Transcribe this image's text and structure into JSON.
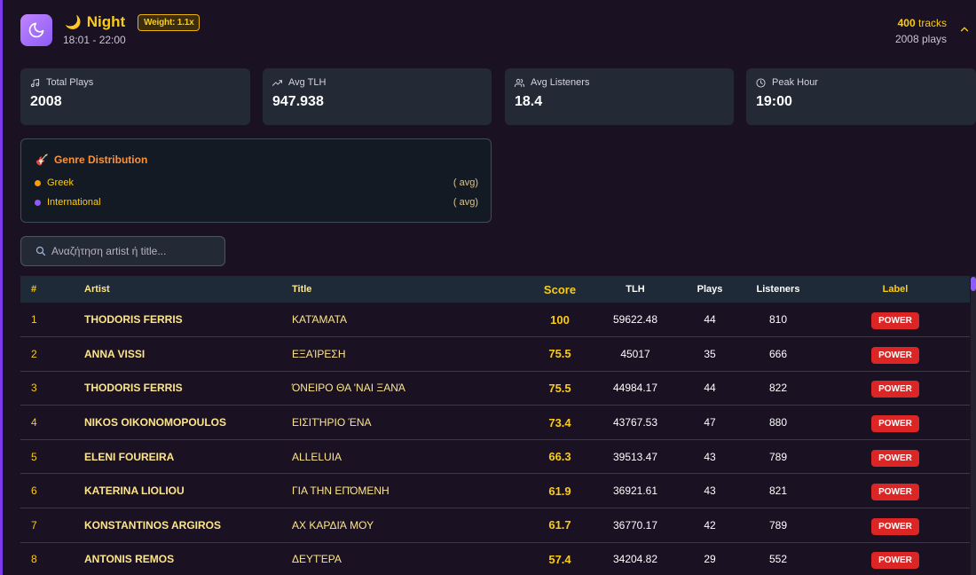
{
  "header": {
    "period_emoji": "🌙",
    "period_name": "Night",
    "weight_badge": "Weight: 1.1x",
    "time_range": "18:01 - 22:00",
    "tracks_count": "400",
    "tracks_word": "tracks",
    "plays_summary": "2008 plays",
    "icon": "moon-icon",
    "collapse_icon": "chevron-up-icon"
  },
  "stats": [
    {
      "icon": "music-note-icon",
      "label": "Total Plays",
      "value": "2008"
    },
    {
      "icon": "trending-up-icon",
      "label": "Avg TLH",
      "value": "947.938"
    },
    {
      "icon": "users-icon",
      "label": "Avg Listeners",
      "value": "18.4"
    },
    {
      "icon": "clock-icon",
      "label": "Peak Hour",
      "value": "19:00"
    }
  ],
  "genre": {
    "title": "Genre Distribution",
    "emoji": "🎸",
    "items": [
      {
        "name": "Greek",
        "value": "( avg)",
        "color": "#f59e0b"
      },
      {
        "name": "International",
        "value": "( avg)",
        "color": "#8b5cf6"
      }
    ]
  },
  "search": {
    "placeholder": "Αναζήτηση artist ή title...",
    "icon": "search-icon"
  },
  "table": {
    "headers": {
      "rank": "#",
      "artist": "Artist",
      "title": "Title",
      "score": "Score",
      "tlh": "TLH",
      "plays": "Plays",
      "listeners": "Listeners",
      "label": "Label"
    },
    "rows": [
      {
        "rank": "1",
        "artist": "THODORIS FERRIS",
        "title": "ΚΑΤΆΜΑΤΑ",
        "score": "100",
        "tlh": "59622.48",
        "plays": "44",
        "listeners": "810",
        "label": "POWER"
      },
      {
        "rank": "2",
        "artist": "ANNA VISSI",
        "title": "ΕΞΑΊΡΕΣΗ",
        "score": "75.5",
        "tlh": "45017",
        "plays": "35",
        "listeners": "666",
        "label": "POWER"
      },
      {
        "rank": "3",
        "artist": "THODORIS FERRIS",
        "title": "ΌΝΕΙΡΟ ΘΑ 'ΝΑΙ ΞΑΝΆ",
        "score": "75.5",
        "tlh": "44984.17",
        "plays": "44",
        "listeners": "822",
        "label": "POWER"
      },
      {
        "rank": "4",
        "artist": "NIKOS OIKONOMOPOULOS",
        "title": "ΕΙΣΙΤΉΡΙΟ ΈΝΑ",
        "score": "73.4",
        "tlh": "43767.53",
        "plays": "47",
        "listeners": "880",
        "label": "POWER"
      },
      {
        "rank": "5",
        "artist": "ELENI FOUREIRA",
        "title": "ALLELUIA",
        "score": "66.3",
        "tlh": "39513.47",
        "plays": "43",
        "listeners": "789",
        "label": "POWER"
      },
      {
        "rank": "6",
        "artist": "KATERINA LIOLIOU",
        "title": "ΓΙΑ ΤΗΝ ΕΠΌΜΕΝΗ",
        "score": "61.9",
        "tlh": "36921.61",
        "plays": "43",
        "listeners": "821",
        "label": "POWER"
      },
      {
        "rank": "7",
        "artist": "KONSTANTINOS ARGIROS",
        "title": "ΑΧ ΚΑΡΔΙΆ ΜΟΥ",
        "score": "61.7",
        "tlh": "36770.17",
        "plays": "42",
        "listeners": "789",
        "label": "POWER"
      },
      {
        "rank": "8",
        "artist": "ANTONIS REMOS",
        "title": "ΔΕΥΤΈΡΑ",
        "score": "57.4",
        "tlh": "34204.82",
        "plays": "29",
        "listeners": "552",
        "label": "POWER"
      }
    ]
  },
  "colors": {
    "accent": "#facc15",
    "background": "#1a1122",
    "card": "#232a36",
    "badge_red": "#dc2626",
    "purple": "#8b5cf6"
  }
}
